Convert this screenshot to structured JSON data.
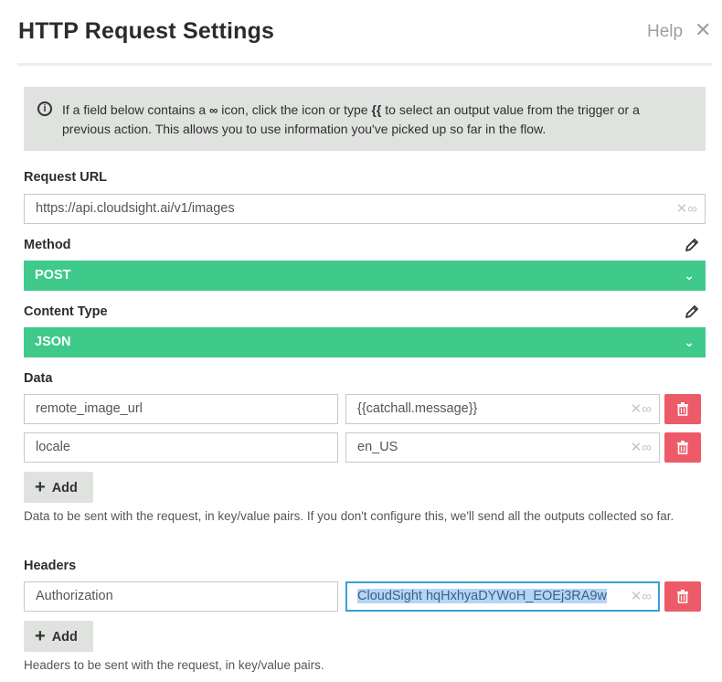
{
  "dialog": {
    "title": "HTTP Request Settings",
    "help_label": "Help",
    "close_glyph": "✕"
  },
  "info": {
    "text_before_icon": "If a field below contains a",
    "text_after_icon": "icon, click the icon or type",
    "braces": "{{",
    "text_end": "to select an output value from the trigger or a previous action. This allows you to use information you've picked up so far in the flow.",
    "icon": "info-circle-icon"
  },
  "request_url": {
    "label": "Request URL",
    "value": "https://api.cloudsight.ai/v1/images"
  },
  "method": {
    "label": "Method",
    "value": "POST"
  },
  "content_type": {
    "label": "Content Type",
    "value": "JSON"
  },
  "data": {
    "label": "Data",
    "rows": [
      {
        "key": "remote_image_url",
        "value": "{{catchall.message}}"
      },
      {
        "key": "locale",
        "value": "en_US"
      }
    ],
    "add_label": "Add",
    "hint": "Data to be sent with the request, in key/value pairs. If you don't configure this, we'll send all the outputs collected so far."
  },
  "headers": {
    "label": "Headers",
    "rows": [
      {
        "key": "Authorization",
        "value": "CloudSight hqHxhyaDYWoH_EOEj3RA9w"
      }
    ],
    "add_label": "Add",
    "hint": "Headers to be sent with the request, in key/value pairs."
  },
  "colors": {
    "select_green": "#3fc98b",
    "delete_red": "#ee5b68",
    "info_bg": "#dfe2df",
    "focus_blue": "#3a9fd6"
  }
}
